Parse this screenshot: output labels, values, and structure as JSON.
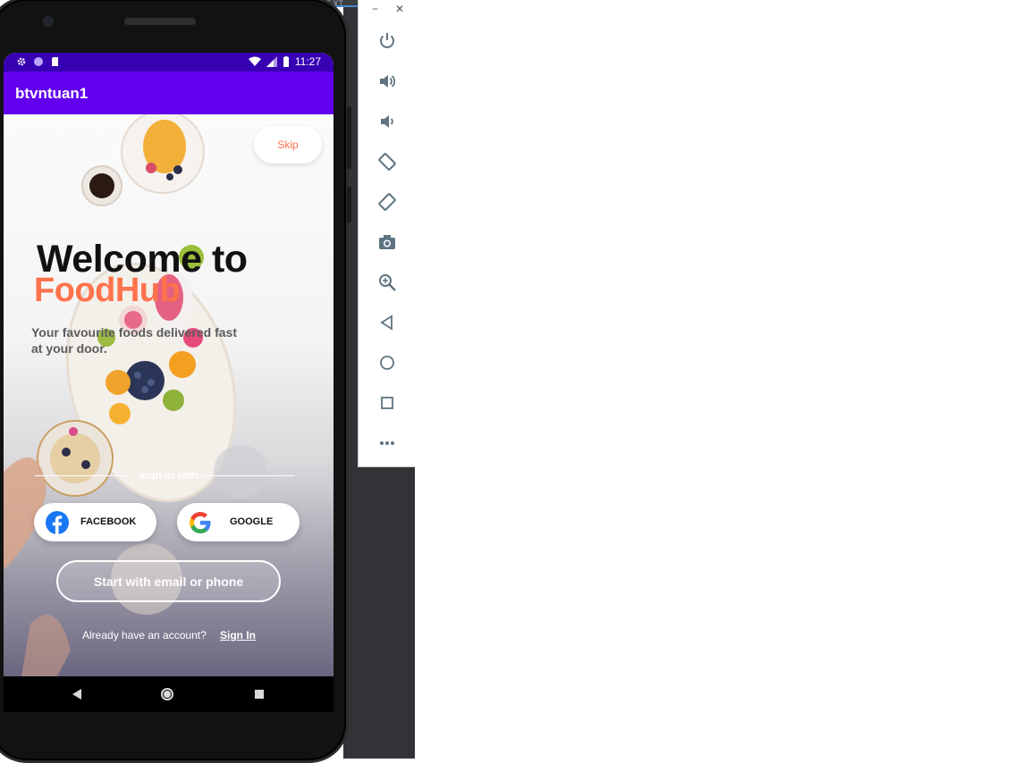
{
  "ide": {
    "tab_text": "E.XT"
  },
  "status_bar": {
    "time": "11:27"
  },
  "app_bar": {
    "title": "btvntuan1"
  },
  "onboarding": {
    "skip_label": "Skip",
    "welcome_line": "Welcome to",
    "brand_line": "FoodHub",
    "tagline": "Your favourite foods delivered fast at your door.",
    "sign_in_with": "sign in with",
    "facebook_label": "FACEBOOK",
    "google_label": "GOOGLE",
    "email_button": "Start with email or phone",
    "account_question": "Already have an account?",
    "sign_in_link": "Sign In"
  },
  "colors": {
    "status_bar": "#3700b3",
    "app_bar": "#6200ee",
    "brand_accent": "#fe724c",
    "facebook_blue": "#1877f2"
  },
  "emulator_toolbar": {
    "items": [
      "power-icon",
      "volume-up-icon",
      "volume-down-icon",
      "rotate-left-icon",
      "rotate-right-icon",
      "camera-icon",
      "zoom-icon",
      "back-icon",
      "home-icon",
      "overview-icon",
      "more-icon"
    ]
  }
}
